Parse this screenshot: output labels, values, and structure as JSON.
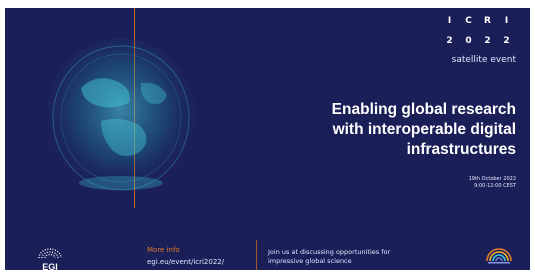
{
  "event": {
    "grid": [
      "I",
      "C",
      "R",
      "I",
      "2",
      "0",
      "2",
      "2"
    ],
    "subtitle": "satellite event"
  },
  "title": {
    "line1": "Enabling global research",
    "line2": "with interoperable digital",
    "line3": "infrastructures"
  },
  "date": {
    "day": "19th October 2022",
    "time": "9:00-12:00 CEST"
  },
  "footer": {
    "egi_logo_text": "EGI",
    "more_info_label": "More info",
    "more_info_url": "egi.eu/event/icri2022/",
    "join_line1": "Join us at discussing opportunities for",
    "join_line2": "impressive global science"
  },
  "colors": {
    "background": "#1b1f58",
    "accent": "#e37b2a",
    "globe": "#3ec6d9"
  }
}
